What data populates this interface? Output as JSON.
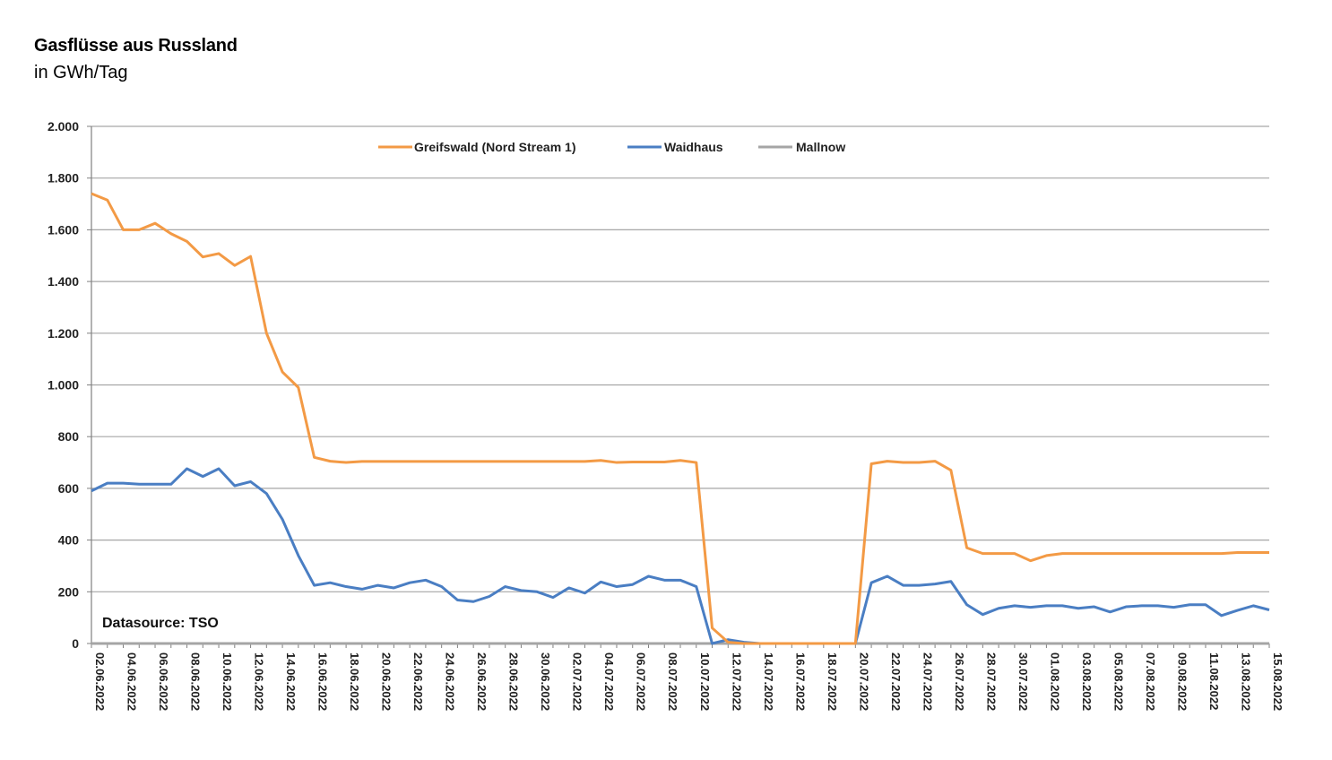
{
  "title": "Gasflüsse aus Russland",
  "subtitle": "in GWh/Tag",
  "source_label": "Datasource: TSO",
  "colors": {
    "greifswald": "#F39A45",
    "waidhaus": "#4A7EC3",
    "mallnow": "#A5A5A5",
    "grid": "#A6A6A6",
    "axis": "#808080"
  },
  "chart_data": {
    "type": "line",
    "x_start": "2022-06-02",
    "x": [
      "02.06.2022",
      "03.06.2022",
      "04.06.2022",
      "05.06.2022",
      "06.06.2022",
      "07.06.2022",
      "08.06.2022",
      "09.06.2022",
      "10.06.2022",
      "11.06.2022",
      "12.06.2022",
      "13.06.2022",
      "14.06.2022",
      "15.06.2022",
      "16.06.2022",
      "17.06.2022",
      "18.06.2022",
      "19.06.2022",
      "20.06.2022",
      "21.06.2022",
      "22.06.2022",
      "23.06.2022",
      "24.06.2022",
      "25.06.2022",
      "26.06.2022",
      "27.06.2022",
      "28.06.2022",
      "29.06.2022",
      "30.06.2022",
      "01.07.2022",
      "02.07.2022",
      "03.07.2022",
      "04.07.2022",
      "05.07.2022",
      "06.07.2022",
      "07.07.2022",
      "08.07.2022",
      "09.07.2022",
      "10.07.2022",
      "11.07.2022",
      "12.07.2022",
      "13.07.2022",
      "14.07.2022",
      "15.07.2022",
      "16.07.2022",
      "17.07.2022",
      "18.07.2022",
      "19.07.2022",
      "20.07.2022",
      "21.07.2022",
      "22.07.2022",
      "23.07.2022",
      "24.07.2022",
      "25.07.2022",
      "26.07.2022",
      "27.07.2022",
      "28.07.2022",
      "29.07.2022",
      "30.07.2022",
      "31.07.2022",
      "01.08.2022",
      "02.08.2022",
      "03.08.2022",
      "04.08.2022",
      "05.08.2022",
      "06.08.2022",
      "07.08.2022",
      "08.08.2022",
      "09.08.2022",
      "10.08.2022",
      "11.08.2022",
      "12.08.2022",
      "13.08.2022",
      "14.08.2022",
      "15.08.2022"
    ],
    "x_tick_labels": [
      "02.06.2022",
      "04.06.2022",
      "06.06.2022",
      "08.06.2022",
      "10.06.2022",
      "12.06.2022",
      "14.06.2022",
      "16.06.2022",
      "18.06.2022",
      "20.06.2022",
      "22.06.2022",
      "24.06.2022",
      "26.06.2022",
      "28.06.2022",
      "30.06.2022",
      "02.07.2022",
      "04.07.2022",
      "06.07.2022",
      "08.07.2022",
      "10.07.2022",
      "12.07.2022",
      "14.07.2022",
      "16.07.2022",
      "18.07.2022",
      "20.07.2022",
      "22.07.2022",
      "24.07.2022",
      "26.07.2022",
      "28.07.2022",
      "30.07.2022",
      "01.08.2022",
      "03.08.2022",
      "05.08.2022",
      "07.08.2022",
      "09.08.2022",
      "11.08.2022",
      "13.08.2022",
      "15.08.2022"
    ],
    "y_tick_labels": [
      "0",
      "200",
      "400",
      "600",
      "800",
      "1.000",
      "1.200",
      "1.400",
      "1.600",
      "1.800",
      "2.000"
    ],
    "ylim": [
      0,
      2000
    ],
    "grid": true,
    "legend_position": "top-center",
    "series": [
      {
        "name": "Greifswald (Nord Stream 1)",
        "color": "#F39A45",
        "values": [
          1740,
          1715,
          1600,
          1600,
          1625,
          1585,
          1555,
          1495,
          1508,
          1462,
          1497,
          1200,
          1050,
          990,
          720,
          705,
          700,
          704,
          704,
          704,
          704,
          704,
          704,
          704,
          704,
          704,
          704,
          704,
          704,
          704,
          704,
          704,
          708,
          700,
          702,
          702,
          702,
          708,
          700,
          60,
          5,
          0,
          0,
          0,
          0,
          0,
          0,
          0,
          0,
          695,
          705,
          700,
          700,
          705,
          670,
          370,
          348,
          348,
          348,
          320,
          340,
          348,
          348,
          348,
          348,
          348,
          348,
          348,
          348,
          348,
          348,
          348,
          352,
          352,
          352
        ]
      },
      {
        "name": "Waidhaus",
        "color": "#4A7EC3",
        "values": [
          590,
          620,
          620,
          616,
          616,
          616,
          676,
          646,
          676,
          610,
          626,
          580,
          480,
          340,
          225,
          235,
          220,
          210,
          225,
          215,
          235,
          245,
          220,
          168,
          162,
          182,
          220,
          205,
          200,
          178,
          215,
          195,
          238,
          220,
          228,
          260,
          245,
          245,
          220,
          0,
          15,
          5,
          0,
          0,
          0,
          0,
          0,
          0,
          0,
          235,
          260,
          225,
          225,
          230,
          240,
          150,
          112,
          136,
          146,
          140,
          146,
          146,
          136,
          142,
          122,
          142,
          146,
          146,
          140,
          150,
          150,
          108,
          128,
          146,
          130
        ]
      },
      {
        "name": "Mallnow",
        "color": "#A5A5A5",
        "values": [
          0,
          0,
          0,
          0,
          0,
          0,
          0,
          0,
          0,
          0,
          0,
          0,
          0,
          0,
          0,
          0,
          0,
          0,
          0,
          0,
          0,
          0,
          0,
          0,
          0,
          0,
          0,
          0,
          0,
          0,
          0,
          0,
          0,
          0,
          0,
          0,
          0,
          0,
          0,
          0,
          0,
          0,
          0,
          0,
          0,
          0,
          0,
          0,
          0,
          0,
          0,
          0,
          0,
          0,
          0,
          0,
          0,
          0,
          0,
          0,
          0,
          0,
          0,
          0,
          0,
          0,
          0,
          0,
          0,
          0,
          0,
          0,
          0,
          0,
          0
        ]
      }
    ]
  }
}
